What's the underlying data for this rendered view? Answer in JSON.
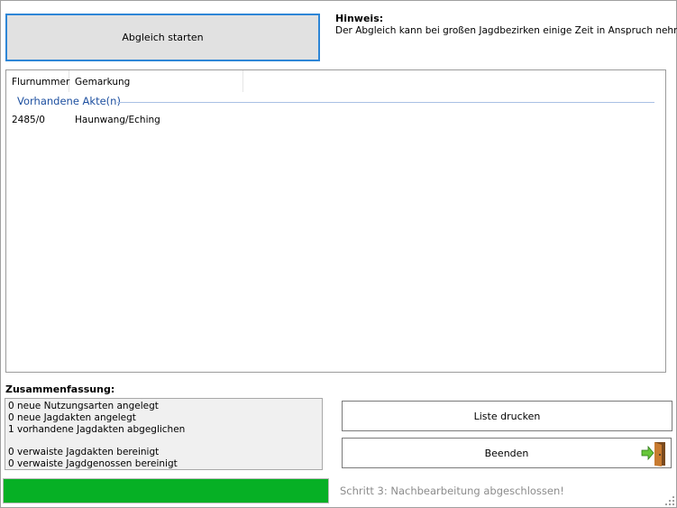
{
  "start_button": {
    "label": "Abgleich starten"
  },
  "hint": {
    "title": "Hinweis:",
    "text": "Der Abgleich kann bei großen Jagdbezirken einige Zeit in Anspruch nehmen."
  },
  "list": {
    "columns": [
      "Flurnummer",
      "Gemarkung"
    ],
    "group": "Vorhandene Akte(n)",
    "rows": [
      {
        "flurnummer": "2485/0",
        "gemarkung": "Haunwang/Eching"
      }
    ]
  },
  "summary": {
    "title": "Zusammenfassung:",
    "lines": [
      "0 neue Nutzungsarten angelegt",
      "0 neue Jagdakten angelegt",
      "1 vorhandene Jagdakten abgeglichen",
      "",
      "0 verwaiste Jagdakten bereinigt",
      "0 verwaiste Jagdgenossen bereinigt"
    ]
  },
  "buttons": {
    "print_label": "Liste drucken",
    "end_label": "Beenden"
  },
  "progress": {
    "value_percent": 100,
    "color": "#06b025"
  },
  "status": {
    "text": "Schritt 3: Nachbearbeitung abgeschlossen!"
  },
  "icons": {
    "end_button_icon": "exit-door-icon"
  },
  "colors": {
    "focus_border": "#2e86d6",
    "group_header": "#1e50a0"
  }
}
